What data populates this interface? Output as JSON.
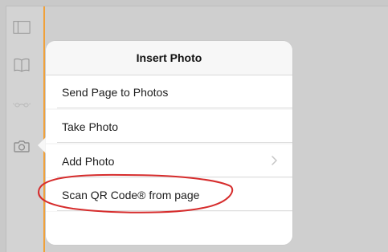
{
  "popover": {
    "title": "Insert Photo",
    "items": [
      {
        "label": "Send Page to Photos"
      },
      {
        "label": "Take Photo"
      },
      {
        "label": "Add Photo",
        "has_chevron": true
      },
      {
        "label": "Scan QR Code® from page"
      }
    ]
  },
  "toolbar": {
    "icons": [
      {
        "name": "sidebar-toggle-icon"
      },
      {
        "name": "book-icon"
      },
      {
        "name": "glasses-icon"
      },
      {
        "name": "camera-icon"
      }
    ]
  },
  "colors": {
    "accent": "#f0a13a",
    "annotation": "#d62c2c",
    "background": "#cfcfcf"
  }
}
